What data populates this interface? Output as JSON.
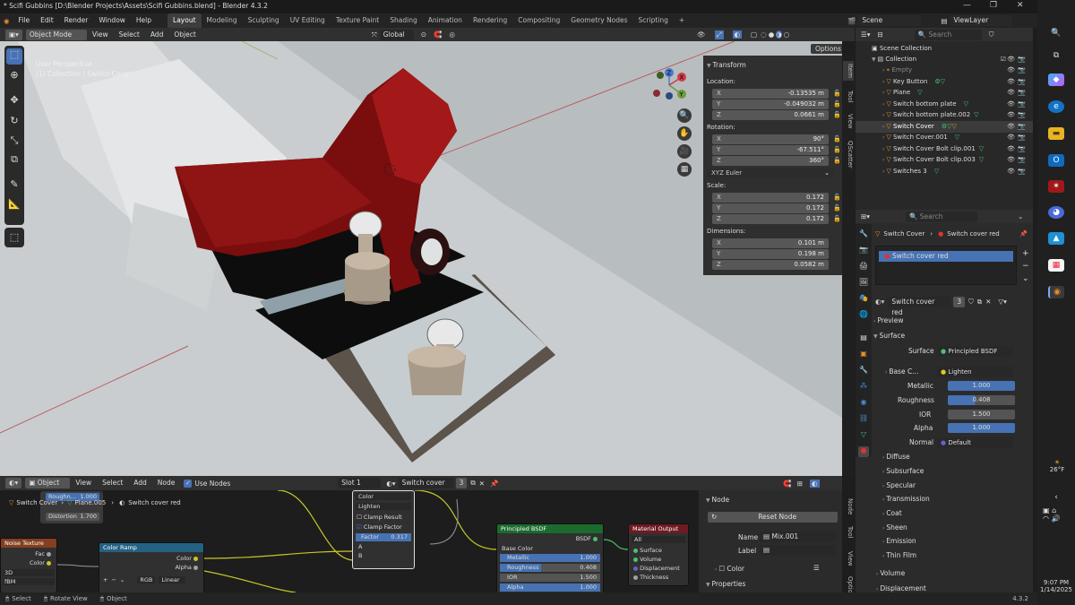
{
  "title": "* Scifi Gubbins [D:\\Blender Projects\\Assets\\Scifi Gubbins.blend] - Blender 4.3.2",
  "menus": [
    "File",
    "Edit",
    "Render",
    "Window",
    "Help"
  ],
  "workspaces": [
    "Layout",
    "Modeling",
    "Sculpting",
    "UV Editing",
    "Texture Paint",
    "Shading",
    "Animation",
    "Rendering",
    "Compositing",
    "Geometry Nodes",
    "Scripting"
  ],
  "topright": {
    "scene": "Scene",
    "viewlayer": "ViewLayer"
  },
  "viewport_header": {
    "mode": "Object Mode",
    "menus": [
      "View",
      "Select",
      "Add",
      "Object"
    ],
    "transform": "Global",
    "options": "Options"
  },
  "viewport": {
    "perspective": "User Perspective",
    "collection": "(1) Collection | Switch Cover"
  },
  "npanel": {
    "tabs": [
      "Item",
      "Tool",
      "View",
      "QScatter"
    ],
    "transform": "Transform",
    "location_label": "Location:",
    "location": [
      {
        "k": "X",
        "v": "-0.13535 m"
      },
      {
        "k": "Y",
        "v": "-0.049032 m"
      },
      {
        "k": "Z",
        "v": "0.0661 m"
      }
    ],
    "rotation_label": "Rotation:",
    "rotation": [
      {
        "k": "X",
        "v": "90°"
      },
      {
        "k": "Y",
        "v": "-67.511°"
      },
      {
        "k": "Z",
        "v": "360°"
      }
    ],
    "euler": "XYZ Euler",
    "scale_label": "Scale:",
    "scale": [
      {
        "k": "X",
        "v": "0.172"
      },
      {
        "k": "Y",
        "v": "0.172"
      },
      {
        "k": "Z",
        "v": "0.172"
      }
    ],
    "dimensions_label": "Dimensions:",
    "dimensions": [
      {
        "k": "X",
        "v": "0.101 m"
      },
      {
        "k": "Y",
        "v": "0.198 m"
      },
      {
        "k": "Z",
        "v": "0.0582 m"
      }
    ]
  },
  "outliner": {
    "search": "Search",
    "scene_collection": "Scene Collection",
    "collection": "Collection",
    "items": [
      "Empty",
      "Key Button",
      "Plane",
      "Switch bottom plate",
      "Switch bottom plate.002",
      "Switch Cover",
      "Switch Cover.001",
      "Switch Cover Bolt clip.001",
      "Switch Cover Bolt clip.003",
      "Switches 3"
    ]
  },
  "properties": {
    "search": "Search",
    "breadcrumb_obj": "Switch Cover",
    "breadcrumb_mat": "Switch cover red",
    "slot": "Switch cover red",
    "material": "Switch cover red",
    "users": "3",
    "preview": "Preview",
    "surface_section": "Surface",
    "surface_label": "Surface",
    "surface_value": "Principled BSDF",
    "basecolor_label": "Base C...",
    "basecolor_value": "Lighten",
    "metallic_label": "Metallic",
    "metallic": "1.000",
    "roughness_label": "Roughness",
    "roughness": "0.408",
    "ior_label": "IOR",
    "ior": "1.500",
    "alpha_label": "Alpha",
    "alpha": "1.000",
    "normal_label": "Normal",
    "normal": "Default",
    "sections": [
      "Diffuse",
      "Subsurface",
      "Specular",
      "Transmission",
      "Coat",
      "Sheen",
      "Emission",
      "Thin Film"
    ],
    "volume": "Volume",
    "displacement": "Displacement"
  },
  "node_header": {
    "editor": "Object",
    "menus": [
      "View",
      "Select",
      "Add",
      "Node"
    ],
    "use_nodes": "Use Nodes",
    "slot": "Slot 1",
    "material": "Switch cover red",
    "users": "3"
  },
  "node_breadcrumb": {
    "a": "Switch Cover",
    "b": "Plane.005",
    "c": "Switch cover red"
  },
  "nodes": {
    "popup": {
      "roughness": "Roughn...",
      "roughness_v": "1.000",
      "distortion": "Distortion",
      "distortion_v": "1.700"
    },
    "noise": {
      "title": "Noise Texture",
      "fac": "Fac",
      "color": "Color",
      "dim": "3D",
      "type": "fBM"
    },
    "ramp": {
      "title": "Color Ramp",
      "color": "Color",
      "alpha": "Alpha",
      "mode": "RGB",
      "interp": "Linear"
    },
    "mix": {
      "color": "Color",
      "blend": "Lighten",
      "clamp_result": "Clamp Result",
      "clamp_factor": "Clamp Factor",
      "factor": "Factor",
      "factor_v": "0.317",
      "a": "A",
      "b": "B"
    },
    "bsdf": {
      "title": "Principled BSDF",
      "out": "BSDF",
      "base_color": "Base Color",
      "metallic": "Metallic",
      "metallic_v": "1.000",
      "roughness": "Roughness",
      "roughness_v": "0.408",
      "ior": "IOR",
      "ior_v": "1.500",
      "alpha": "Alpha",
      "alpha_v": "1.000"
    },
    "output": {
      "title": "Material Output",
      "target": "All",
      "surface": "Surface",
      "volume": "Volume",
      "displacement": "Displacement",
      "thickness": "Thickness"
    }
  },
  "node_panel": {
    "section": "Node",
    "reset": "Reset Node",
    "name_label": "Name",
    "name": "Mix.001",
    "label_label": "Label",
    "color": "Color",
    "properties": "Properties",
    "tabs": [
      "Node",
      "Tool",
      "View",
      "Optio"
    ]
  },
  "status": {
    "select": "Select",
    "rotate": "Rotate View",
    "object": "Object",
    "version": "4.3.2"
  },
  "taskbar": {
    "temp": "26°F",
    "time": "9:07 PM",
    "date": "1/14/2025"
  }
}
